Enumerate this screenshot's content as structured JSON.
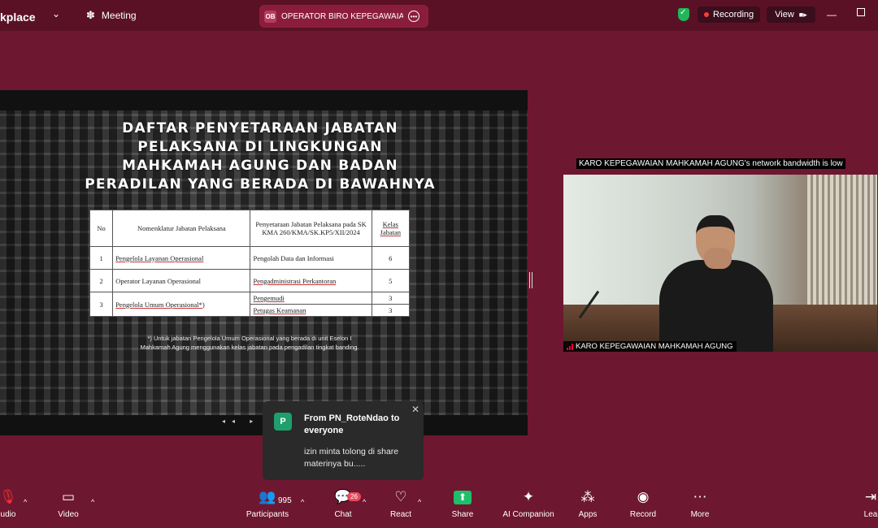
{
  "topbar": {
    "app_name": "kplace",
    "meeting_label": "Meeting",
    "tab_badge": "OB",
    "tab_title": "OPERATOR BIRO KEPEGAWAIAN MAHKAMAH AGUNG",
    "recording_label": "Recording",
    "view_label": "View"
  },
  "slide": {
    "title_lines": [
      "DAFTAR PENYETARAAN JABATAN",
      "PELAKSANA DI LINGKUNGAN",
      "MAHKAMAH AGUNG DAN BADAN",
      "PERADILAN YANG BERADA DI BAWAHNYA"
    ],
    "table": {
      "headers": [
        "No",
        "Nomenklatur Jabatan Pelaksana",
        "Penyetaraan Jabatan Pelaksana pada SK KMA 260/KMA/SK.KP5/XII/2024",
        "Kelas Jabatan"
      ],
      "rows": [
        {
          "no": "1",
          "nomenklatur": "Pengelola Layanan Operasional",
          "penyetaraan": "Pengolah Data dan Informasi",
          "kelas": "6"
        },
        {
          "no": "2",
          "nomenklatur": "Operator Layanan Operasional",
          "penyetaraan": "Pengadministrasi Perkantoran",
          "kelas": "5"
        },
        {
          "no": "3",
          "nomenklatur": "Pengelola Umum Operasional*)",
          "penyetaraan": "Pengemudi",
          "kelas": "3",
          "penyetaraan2": "Petugas Keamanan",
          "kelas2": "3"
        }
      ]
    },
    "note_line1": "*) Untuk jabatan Pengelola Umum Operasional yang berada di unit Eselon I",
    "note_line2": "Mahkamah Agung menggunakan kelas jabatan pada pengadilan tingkat banding.",
    "controls": "◂◂ ▸ ▸▸"
  },
  "video": {
    "bandwidth_notice": "KARO KEPEGAWAIAN MAHKAMAH AGUNG's network bandwidth is low",
    "participant_name": "KARO KEPEGAWAIAN MAHKAMAH AGUNG"
  },
  "chat_popup": {
    "avatar_letter": "P",
    "from": "From PN_RoteNdao to everyone",
    "message": "izin minta tolong di share materinya bu....."
  },
  "toolbar": {
    "audio": "udio",
    "video": "Video",
    "participants": "Participants",
    "participants_count": "995",
    "chat": "Chat",
    "chat_badge": "26",
    "react": "React",
    "share": "Share",
    "ai_companion": "AI Companion",
    "apps": "Apps",
    "record": "Record",
    "more": "More",
    "leave": "Lea"
  },
  "colors": {
    "background": "#6e1730",
    "accent_green": "#1fbf6a",
    "badge_red": "#e8485d"
  }
}
